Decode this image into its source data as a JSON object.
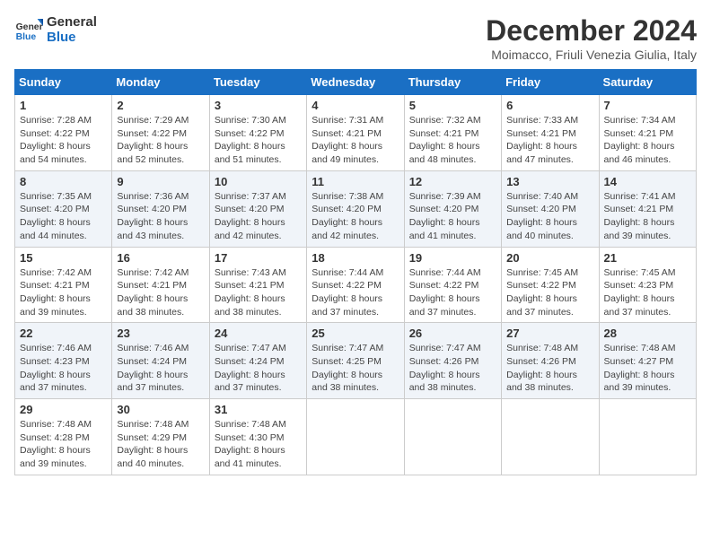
{
  "logo": {
    "text_general": "General",
    "text_blue": "Blue"
  },
  "title": "December 2024",
  "subtitle": "Moimacco, Friuli Venezia Giulia, Italy",
  "days_of_week": [
    "Sunday",
    "Monday",
    "Tuesday",
    "Wednesday",
    "Thursday",
    "Friday",
    "Saturday"
  ],
  "weeks": [
    [
      {
        "day": "1",
        "sunrise": "Sunrise: 7:28 AM",
        "sunset": "Sunset: 4:22 PM",
        "daylight": "Daylight: 8 hours and 54 minutes."
      },
      {
        "day": "2",
        "sunrise": "Sunrise: 7:29 AM",
        "sunset": "Sunset: 4:22 PM",
        "daylight": "Daylight: 8 hours and 52 minutes."
      },
      {
        "day": "3",
        "sunrise": "Sunrise: 7:30 AM",
        "sunset": "Sunset: 4:22 PM",
        "daylight": "Daylight: 8 hours and 51 minutes."
      },
      {
        "day": "4",
        "sunrise": "Sunrise: 7:31 AM",
        "sunset": "Sunset: 4:21 PM",
        "daylight": "Daylight: 8 hours and 49 minutes."
      },
      {
        "day": "5",
        "sunrise": "Sunrise: 7:32 AM",
        "sunset": "Sunset: 4:21 PM",
        "daylight": "Daylight: 8 hours and 48 minutes."
      },
      {
        "day": "6",
        "sunrise": "Sunrise: 7:33 AM",
        "sunset": "Sunset: 4:21 PM",
        "daylight": "Daylight: 8 hours and 47 minutes."
      },
      {
        "day": "7",
        "sunrise": "Sunrise: 7:34 AM",
        "sunset": "Sunset: 4:21 PM",
        "daylight": "Daylight: 8 hours and 46 minutes."
      }
    ],
    [
      {
        "day": "8",
        "sunrise": "Sunrise: 7:35 AM",
        "sunset": "Sunset: 4:20 PM",
        "daylight": "Daylight: 8 hours and 44 minutes."
      },
      {
        "day": "9",
        "sunrise": "Sunrise: 7:36 AM",
        "sunset": "Sunset: 4:20 PM",
        "daylight": "Daylight: 8 hours and 43 minutes."
      },
      {
        "day": "10",
        "sunrise": "Sunrise: 7:37 AM",
        "sunset": "Sunset: 4:20 PM",
        "daylight": "Daylight: 8 hours and 42 minutes."
      },
      {
        "day": "11",
        "sunrise": "Sunrise: 7:38 AM",
        "sunset": "Sunset: 4:20 PM",
        "daylight": "Daylight: 8 hours and 42 minutes."
      },
      {
        "day": "12",
        "sunrise": "Sunrise: 7:39 AM",
        "sunset": "Sunset: 4:20 PM",
        "daylight": "Daylight: 8 hours and 41 minutes."
      },
      {
        "day": "13",
        "sunrise": "Sunrise: 7:40 AM",
        "sunset": "Sunset: 4:20 PM",
        "daylight": "Daylight: 8 hours and 40 minutes."
      },
      {
        "day": "14",
        "sunrise": "Sunrise: 7:41 AM",
        "sunset": "Sunset: 4:21 PM",
        "daylight": "Daylight: 8 hours and 39 minutes."
      }
    ],
    [
      {
        "day": "15",
        "sunrise": "Sunrise: 7:42 AM",
        "sunset": "Sunset: 4:21 PM",
        "daylight": "Daylight: 8 hours and 39 minutes."
      },
      {
        "day": "16",
        "sunrise": "Sunrise: 7:42 AM",
        "sunset": "Sunset: 4:21 PM",
        "daylight": "Daylight: 8 hours and 38 minutes."
      },
      {
        "day": "17",
        "sunrise": "Sunrise: 7:43 AM",
        "sunset": "Sunset: 4:21 PM",
        "daylight": "Daylight: 8 hours and 38 minutes."
      },
      {
        "day": "18",
        "sunrise": "Sunrise: 7:44 AM",
        "sunset": "Sunset: 4:22 PM",
        "daylight": "Daylight: 8 hours and 37 minutes."
      },
      {
        "day": "19",
        "sunrise": "Sunrise: 7:44 AM",
        "sunset": "Sunset: 4:22 PM",
        "daylight": "Daylight: 8 hours and 37 minutes."
      },
      {
        "day": "20",
        "sunrise": "Sunrise: 7:45 AM",
        "sunset": "Sunset: 4:22 PM",
        "daylight": "Daylight: 8 hours and 37 minutes."
      },
      {
        "day": "21",
        "sunrise": "Sunrise: 7:45 AM",
        "sunset": "Sunset: 4:23 PM",
        "daylight": "Daylight: 8 hours and 37 minutes."
      }
    ],
    [
      {
        "day": "22",
        "sunrise": "Sunrise: 7:46 AM",
        "sunset": "Sunset: 4:23 PM",
        "daylight": "Daylight: 8 hours and 37 minutes."
      },
      {
        "day": "23",
        "sunrise": "Sunrise: 7:46 AM",
        "sunset": "Sunset: 4:24 PM",
        "daylight": "Daylight: 8 hours and 37 minutes."
      },
      {
        "day": "24",
        "sunrise": "Sunrise: 7:47 AM",
        "sunset": "Sunset: 4:24 PM",
        "daylight": "Daylight: 8 hours and 37 minutes."
      },
      {
        "day": "25",
        "sunrise": "Sunrise: 7:47 AM",
        "sunset": "Sunset: 4:25 PM",
        "daylight": "Daylight: 8 hours and 38 minutes."
      },
      {
        "day": "26",
        "sunrise": "Sunrise: 7:47 AM",
        "sunset": "Sunset: 4:26 PM",
        "daylight": "Daylight: 8 hours and 38 minutes."
      },
      {
        "day": "27",
        "sunrise": "Sunrise: 7:48 AM",
        "sunset": "Sunset: 4:26 PM",
        "daylight": "Daylight: 8 hours and 38 minutes."
      },
      {
        "day": "28",
        "sunrise": "Sunrise: 7:48 AM",
        "sunset": "Sunset: 4:27 PM",
        "daylight": "Daylight: 8 hours and 39 minutes."
      }
    ],
    [
      {
        "day": "29",
        "sunrise": "Sunrise: 7:48 AM",
        "sunset": "Sunset: 4:28 PM",
        "daylight": "Daylight: 8 hours and 39 minutes."
      },
      {
        "day": "30",
        "sunrise": "Sunrise: 7:48 AM",
        "sunset": "Sunset: 4:29 PM",
        "daylight": "Daylight: 8 hours and 40 minutes."
      },
      {
        "day": "31",
        "sunrise": "Sunrise: 7:48 AM",
        "sunset": "Sunset: 4:30 PM",
        "daylight": "Daylight: 8 hours and 41 minutes."
      },
      null,
      null,
      null,
      null
    ]
  ]
}
